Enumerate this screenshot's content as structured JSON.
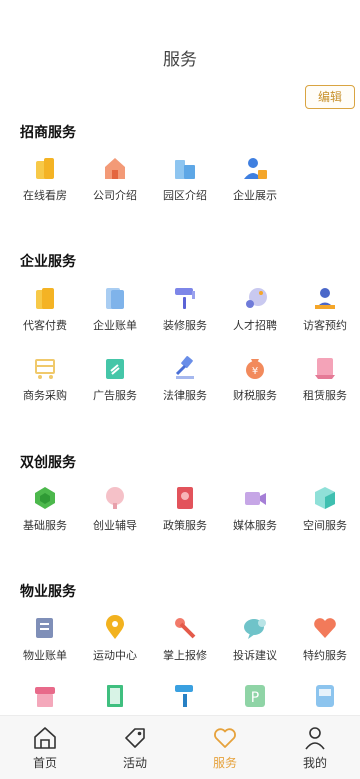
{
  "header": {
    "title": "服务",
    "edit_label": "编辑"
  },
  "sections": [
    {
      "title": "招商服务",
      "rows": [
        [
          {
            "label": "在线看房",
            "icon": "building-icon"
          },
          {
            "label": "公司介绍",
            "icon": "house-icon"
          },
          {
            "label": "园区介绍",
            "icon": "office-buildings-icon"
          },
          {
            "label": "企业展示",
            "icon": "person-id-icon"
          }
        ]
      ]
    },
    {
      "title": "企业服务",
      "rows": [
        [
          {
            "label": "代客付费",
            "icon": "wallet-icon"
          },
          {
            "label": "企业账单",
            "icon": "bill-icon"
          },
          {
            "label": "装修服务",
            "icon": "paint-roller-icon"
          },
          {
            "label": "人才招聘",
            "icon": "search-person-icon"
          },
          {
            "label": "访客预约",
            "icon": "visitor-icon"
          }
        ],
        [
          {
            "label": "商务采购",
            "icon": "cart-icon"
          },
          {
            "label": "广告服务",
            "icon": "ad-board-icon"
          },
          {
            "label": "法律服务",
            "icon": "gavel-icon"
          },
          {
            "label": "财税服务",
            "icon": "money-bag-icon"
          },
          {
            "label": "租赁服务",
            "icon": "lease-tag-icon"
          }
        ]
      ]
    },
    {
      "title": "双创服务",
      "rows": [
        [
          {
            "label": "基础服务",
            "icon": "hexagon-icon"
          },
          {
            "label": "创业辅导",
            "icon": "mentor-icon"
          },
          {
            "label": "政策服务",
            "icon": "policy-book-icon"
          },
          {
            "label": "媒体服务",
            "icon": "video-camera-icon"
          },
          {
            "label": "空间服务",
            "icon": "cube-icon"
          }
        ]
      ]
    },
    {
      "title": "物业服务",
      "rows": [
        [
          {
            "label": "物业账单",
            "icon": "ledger-icon"
          },
          {
            "label": "运动中心",
            "icon": "location-pin-icon"
          },
          {
            "label": "掌上报修",
            "icon": "wrench-icon"
          },
          {
            "label": "投诉建议",
            "icon": "chat-bubble-icon"
          },
          {
            "label": "特约服务",
            "icon": "heart-icon"
          }
        ],
        [
          {
            "label": "",
            "icon": "inbox-icon"
          },
          {
            "label": "",
            "icon": "door-icon"
          },
          {
            "label": "",
            "icon": "roller-icon"
          },
          {
            "label": "",
            "icon": "parking-icon"
          },
          {
            "label": "",
            "icon": "bus-icon"
          }
        ]
      ]
    }
  ],
  "tabbar": {
    "tabs": [
      {
        "label": "首页",
        "icon": "home-icon"
      },
      {
        "label": "活动",
        "icon": "tag-icon"
      },
      {
        "label": "服务",
        "icon": "heart-outline-icon",
        "active": true
      },
      {
        "label": "我的",
        "icon": "user-icon"
      }
    ],
    "active_color": "#e6a23c"
  }
}
